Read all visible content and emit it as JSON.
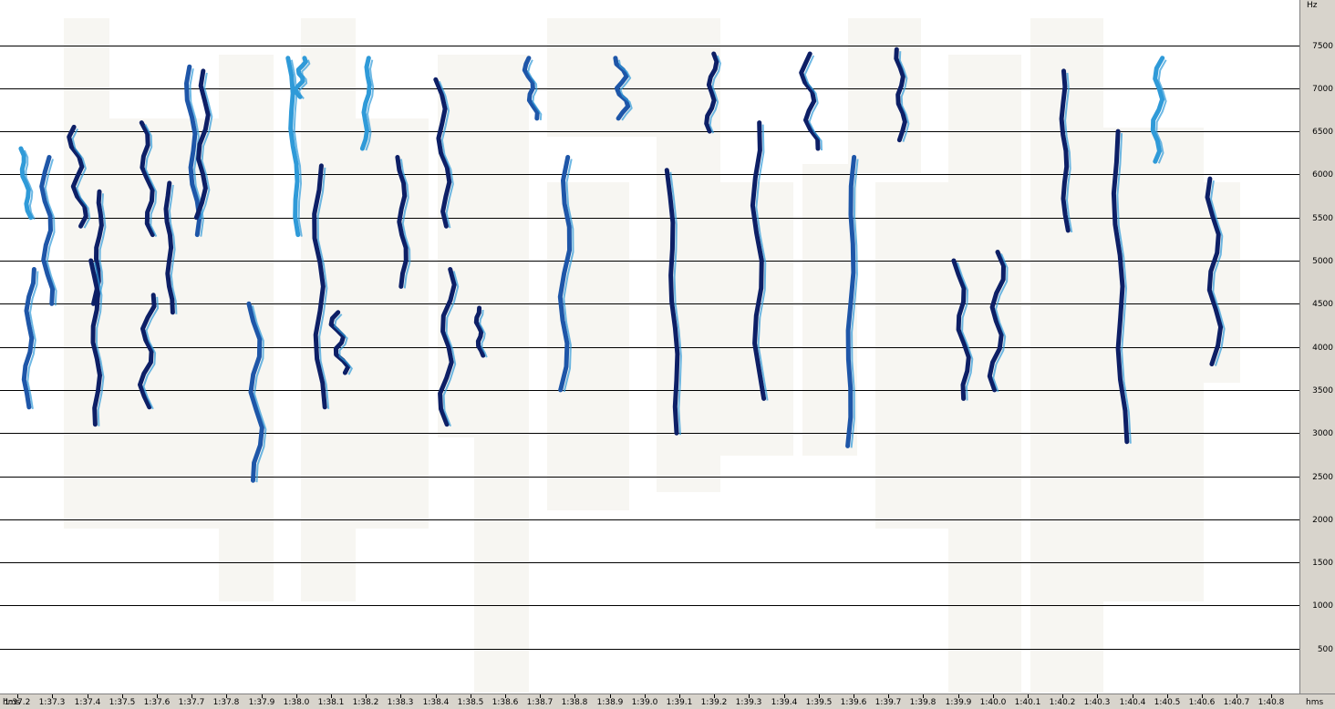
{
  "freq_axis": {
    "unit": "Hz",
    "ticks": [
      "7500",
      "7000",
      "6500",
      "6000",
      "5500",
      "5000",
      "4500",
      "4000",
      "3500",
      "3000",
      "2500",
      "2000",
      "1500",
      "1000",
      "500"
    ]
  },
  "time_axis": {
    "unit_left": "hms",
    "unit_right": "hms",
    "ticks": [
      "1:37.2",
      "1:37.3",
      "1:37.4",
      "1:37.5",
      "1:37.6",
      "1:37.7",
      "1:37.8",
      "1:37.9",
      "1:38.0",
      "1:38.1",
      "1:38.2",
      "1:38.3",
      "1:38.4",
      "1:38.5",
      "1:38.6",
      "1:38.7",
      "1:38.8",
      "1:38.9",
      "1:39.0",
      "1:39.1",
      "1:39.2",
      "1:39.3",
      "1:39.4",
      "1:39.5",
      "1:39.6",
      "1:39.7",
      "1:39.8",
      "1:39.9",
      "1:40.0",
      "1:40.1",
      "1:40.2",
      "1:40.3",
      "1:40.4",
      "1:40.5",
      "1:40.6",
      "1:40.7",
      "1:40.8"
    ]
  },
  "colors": {
    "dark_trace": "#0d1f66",
    "mid_trace": "#1e56a8",
    "light_trace": "#2f9ad8",
    "background_haze": "#f7f6f2",
    "gridline": "#000000",
    "axis_bg": "#d8d4cc"
  },
  "chart_data": {
    "type": "spectrogram",
    "x_unit": "hms",
    "y_unit": "Hz",
    "xlim": [
      "1:37.15",
      "1:40.88"
    ],
    "ylim": [
      0,
      8000
    ],
    "grid": true,
    "syllables": [
      {
        "t": "1:37.21",
        "f": [
          6300,
          5500
        ],
        "shade": "light"
      },
      {
        "t": "1:37.24",
        "f": [
          4900,
          3300
        ],
        "shade": "mid"
      },
      {
        "t": "1:37.28",
        "f": [
          6200,
          4500
        ],
        "shade": "mid"
      },
      {
        "t": "1:37.36",
        "f": [
          6550,
          5400
        ],
        "shade": "dark"
      },
      {
        "t": "1:37.44",
        "f": [
          5800,
          4500
        ],
        "shade": "dark"
      },
      {
        "t": "1:37.42",
        "f": [
          5000,
          3100
        ],
        "shade": "dark"
      },
      {
        "t": "1:37.56",
        "f": [
          6600,
          5300
        ],
        "shade": "dark"
      },
      {
        "t": "1:37.58",
        "f": [
          4600,
          3300
        ],
        "shade": "dark"
      },
      {
        "t": "1:37.63",
        "f": [
          5900,
          4400
        ],
        "shade": "dark"
      },
      {
        "t": "1:37.69",
        "f": [
          7250,
          5300
        ],
        "shade": "mid"
      },
      {
        "t": "1:37.74",
        "f": [
          7200,
          5500
        ],
        "shade": "dark"
      },
      {
        "t": "1:37.88",
        "f": [
          4500,
          2450
        ],
        "shade": "mid"
      },
      {
        "t": "1:37.98",
        "f": [
          7350,
          5300
        ],
        "shade": "light"
      },
      {
        "t": "1:38.02",
        "f": [
          7350,
          6900
        ],
        "shade": "light"
      },
      {
        "t": "1:38.06",
        "f": [
          6100,
          3300
        ],
        "shade": "dark"
      },
      {
        "t": "1:38.11",
        "f": [
          4400,
          3700
        ],
        "shade": "dark"
      },
      {
        "t": "1:38.21",
        "f": [
          7350,
          6300
        ],
        "shade": "light"
      },
      {
        "t": "1:38.30",
        "f": [
          6200,
          4700
        ],
        "shade": "dark"
      },
      {
        "t": "1:38.41",
        "f": [
          7100,
          5400
        ],
        "shade": "dark"
      },
      {
        "t": "1:38.44",
        "f": [
          4900,
          3100
        ],
        "shade": "dark"
      },
      {
        "t": "1:38.52",
        "f": [
          4450,
          3900
        ],
        "shade": "dark"
      },
      {
        "t": "1:38.66",
        "f": [
          7350,
          6650
        ],
        "shade": "mid"
      },
      {
        "t": "1:38.78",
        "f": [
          6200,
          3500
        ],
        "shade": "mid"
      },
      {
        "t": "1:38.93",
        "f": [
          7350,
          6650
        ],
        "shade": "mid"
      },
      {
        "t": "1:39.07",
        "f": [
          6050,
          3000
        ],
        "shade": "dark"
      },
      {
        "t": "1:39.20",
        "f": [
          7400,
          6500
        ],
        "shade": "dark"
      },
      {
        "t": "1:39.32",
        "f": [
          6600,
          3400
        ],
        "shade": "dark"
      },
      {
        "t": "1:39.46",
        "f": [
          7400,
          6300
        ],
        "shade": "dark"
      },
      {
        "t": "1:39.60",
        "f": [
          6200,
          2850
        ],
        "shade": "mid"
      },
      {
        "t": "1:39.73",
        "f": [
          7450,
          6400
        ],
        "shade": "dark"
      },
      {
        "t": "1:39.90",
        "f": [
          5000,
          3400
        ],
        "shade": "dark"
      },
      {
        "t": "1:40.02",
        "f": [
          5100,
          3500
        ],
        "shade": "dark"
      },
      {
        "t": "1:40.20",
        "f": [
          7200,
          5350
        ],
        "shade": "dark"
      },
      {
        "t": "1:40.35",
        "f": [
          6500,
          2900
        ],
        "shade": "dark"
      },
      {
        "t": "1:40.48",
        "f": [
          7350,
          6150
        ],
        "shade": "light"
      },
      {
        "t": "1:40.63",
        "f": [
          5950,
          3800
        ],
        "shade": "dark"
      }
    ]
  }
}
